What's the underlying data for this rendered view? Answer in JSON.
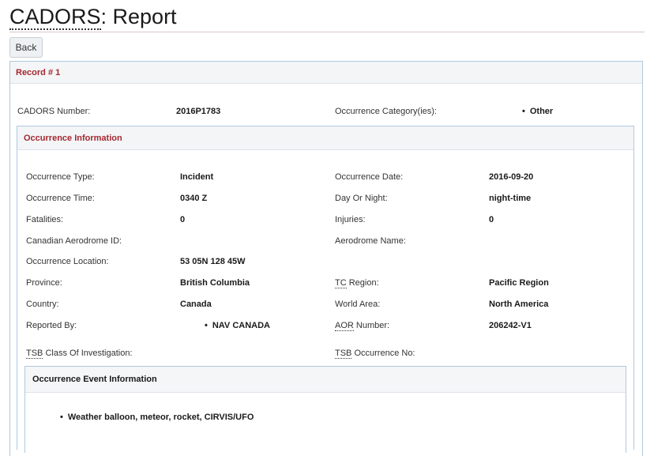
{
  "page": {
    "title_abbr": "CADORS",
    "title_rest": ": Report"
  },
  "toolbar": {
    "back_label": "Back"
  },
  "record": {
    "heading": "Record # 1",
    "cadors_number_label": "CADORS Number:",
    "cadors_number": "2016P1783",
    "category_label": "Occurrence Category(ies):",
    "categories": [
      "Other"
    ]
  },
  "occurrence": {
    "heading": "Occurrence Information",
    "fields": {
      "type_label": "Occurrence Type:",
      "type": "Incident",
      "date_label": "Occurrence Date:",
      "date": "2016-09-20",
      "time_label": "Occurrence Time:",
      "time": "0340 Z",
      "daynight_label": "Day Or Night:",
      "daynight": "night-time",
      "fatalities_label": "Fatalities:",
      "fatalities": "0",
      "injuries_label": "Injuries:",
      "injuries": "0",
      "aerodrome_id_label": "Canadian Aerodrome ID:",
      "aerodrome_name_label": "Aerodrome Name:",
      "location_label": "Occurrence Location:",
      "location": "53 05N 128 45W",
      "province_label": "Province:",
      "province": "British Columbia",
      "tc_region_abbr": "TC",
      "tc_region_rest": " Region:",
      "tc_region": "Pacific Region",
      "country_label": "Country:",
      "country": "Canada",
      "world_area_label": "World Area:",
      "world_area": "North America",
      "reported_by_label": "Reported By:",
      "reported_by": "NAV CANADA",
      "aor_abbr": "AOR",
      "aor_rest": " Number:",
      "aor_number": "206242-V1",
      "tsb_class_abbr": "TSB",
      "tsb_class_rest": " Class Of Investigation:",
      "tsb_no_abbr": "TSB",
      "tsb_no_rest": " Occurrence No:"
    }
  },
  "event": {
    "heading": "Occurrence Event Information",
    "items": [
      "Weather balloon, meteor, rocket, CIRVIS/UFO"
    ]
  }
}
